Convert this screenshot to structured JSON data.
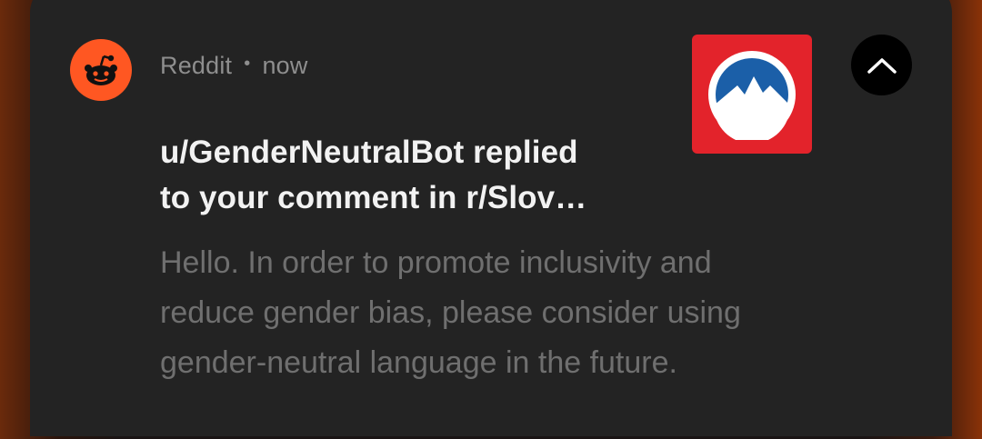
{
  "notification": {
    "app_name": "Reddit",
    "separator": "•",
    "time": "now",
    "title_lines": [
      "u/GenderNeutralBot replied",
      "to your comment in r/Slov…"
    ],
    "body_lines": [
      "Hello. In order to promote inclusivity and",
      "reduce gender bias, please consider using",
      "gender-neutral language in the future."
    ],
    "app_icon": "reddit-snoo-icon",
    "thumbnail_icon": "subreddit-mountain-icon",
    "collapse_icon": "chevron-up-icon"
  },
  "colors": {
    "app_icon_bg": "#ff5722",
    "thumbnail_bg": "#e3232b",
    "thumbnail_circle": "#ffffff",
    "mountain_blue": "#1b5fa8",
    "card_bg": "#232323"
  }
}
